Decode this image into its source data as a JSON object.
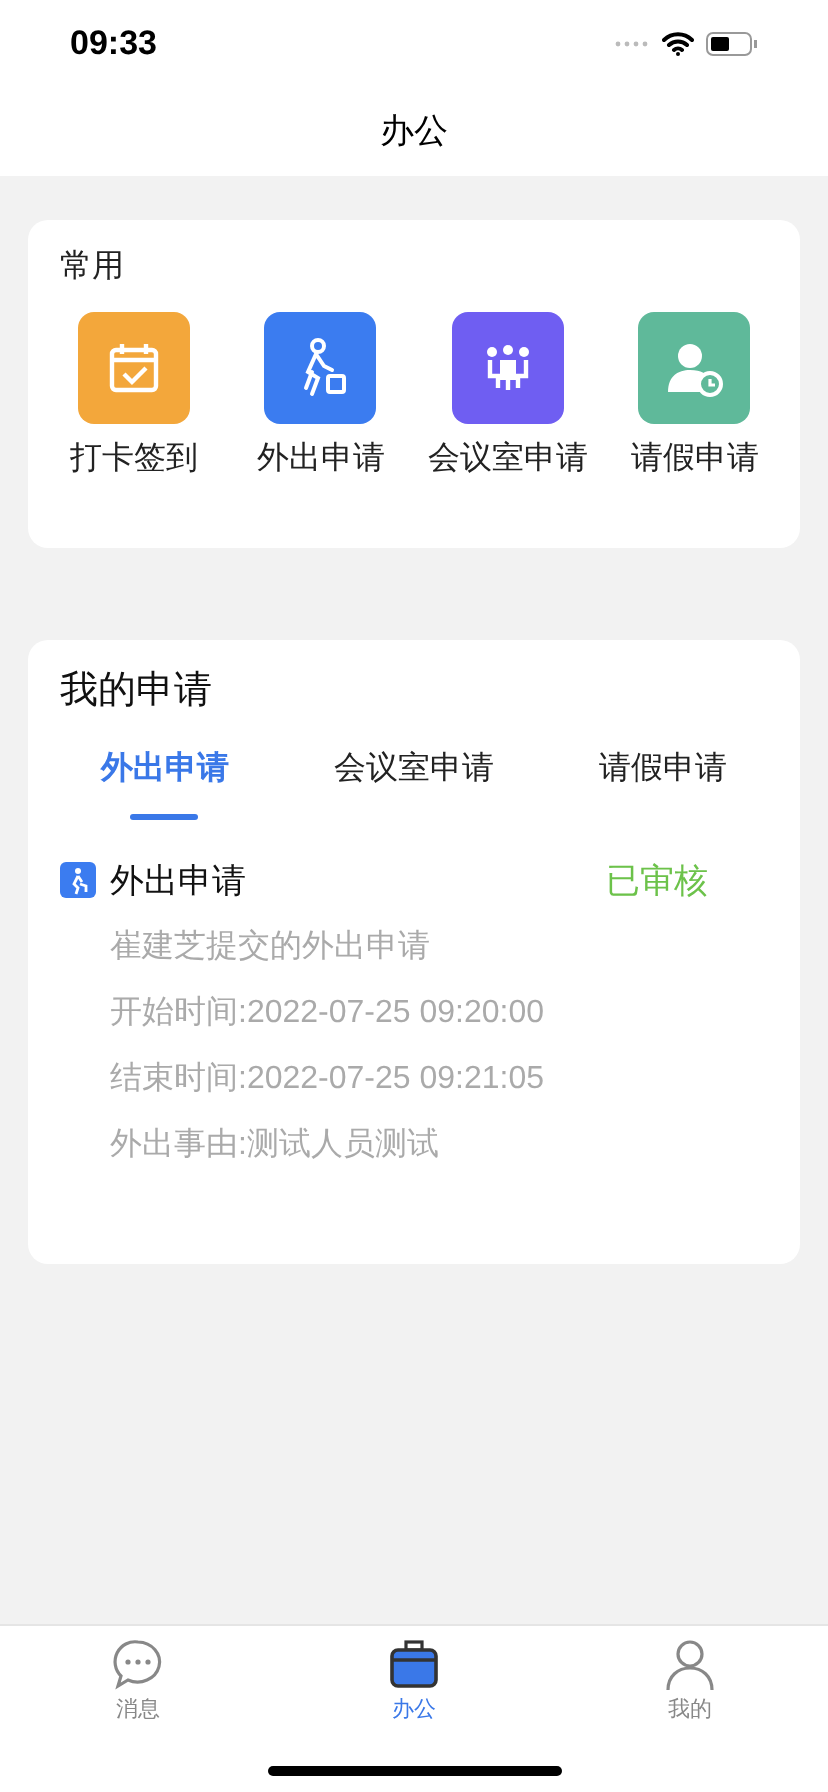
{
  "status_bar": {
    "time": "09:33"
  },
  "nav": {
    "title": "办公"
  },
  "common": {
    "title": "常用",
    "items": [
      {
        "label": "打卡签到",
        "kind": "checkin",
        "color": "#f3a73b"
      },
      {
        "label": "外出申请",
        "kind": "outing",
        "color": "#3b7cf0"
      },
      {
        "label": "会议室申请",
        "kind": "meeting",
        "color": "#6f5ef2"
      },
      {
        "label": "请假申请",
        "kind": "leave",
        "color": "#5fb99a"
      }
    ]
  },
  "my_requests": {
    "title": "我的申请",
    "tabs": [
      {
        "label": "外出申请",
        "selected": true
      },
      {
        "label": "会议室申请",
        "selected": false
      },
      {
        "label": "请假申请",
        "selected": false
      }
    ],
    "entries": [
      {
        "title": "外出申请",
        "status": "已审核",
        "lines": [
          "崔建芝提交的外出申请",
          "开始时间:2022-07-25 09:20:00",
          "结束时间:2022-07-25 09:21:05",
          "外出事由:测试人员测试"
        ]
      }
    ]
  },
  "tab_bar": [
    {
      "label": "消息",
      "kind": "chat",
      "selected": false
    },
    {
      "label": "办公",
      "kind": "briefcase",
      "selected": true
    },
    {
      "label": "我的",
      "kind": "person",
      "selected": false
    }
  ]
}
